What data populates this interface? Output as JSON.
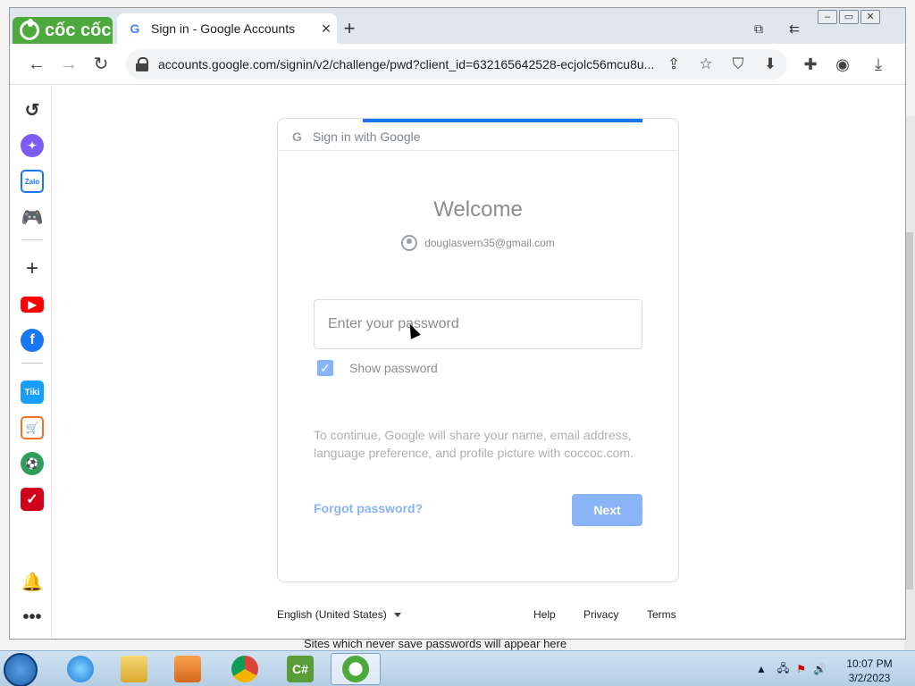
{
  "browser": {
    "brand_label": "cốc cốc",
    "tab_title": "Sign in - Google Accounts",
    "tab_close": "×",
    "new_tab": "+",
    "url": "accounts.google.com/signin/v2/challenge/pwd?client_id=632165642528-ecjolc56mcu8u..."
  },
  "sign_in": {
    "header": "Sign in with Google",
    "welcome": "Welcome",
    "email": "douglasvern35@gmail.com",
    "password_placeholder": "Enter your password",
    "show_password_label": "Show password",
    "show_password_checked": true,
    "consent_text": "To continue, Google will share your name, email address, language preference, and profile picture with coccoc.com.",
    "forgot_password": "Forgot password?",
    "next_button": "Next"
  },
  "footer": {
    "language": "English (United States)",
    "help": "Help",
    "privacy": "Privacy",
    "terms": "Terms"
  },
  "background_text": "Sites which never save passwords will appear here",
  "sidebar": {
    "zalo_label": "Zalo",
    "tiki_label": "Tiki"
  },
  "taskbar": {
    "csharp_label": "C#",
    "time": "10:07 PM",
    "date": "3/2/2023"
  },
  "colors": {
    "brand_green": "#4caa3c",
    "google_blue": "#1a73e8",
    "disabled_blue": "#8ab4f8"
  }
}
